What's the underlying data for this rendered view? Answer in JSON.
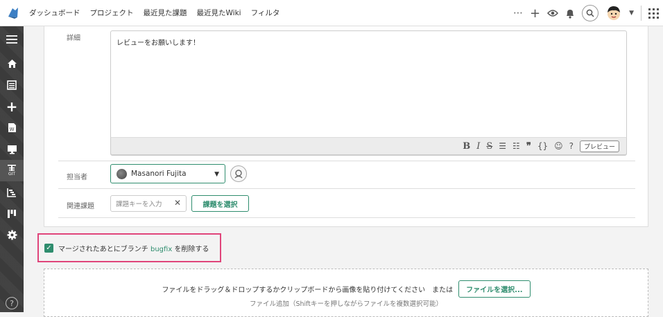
{
  "topbar": {
    "nav": [
      "ダッシュボード",
      "プロジェクト",
      "最近見た課題",
      "最近見たWiki",
      "フィルタ"
    ],
    "icons": [
      "more-icon",
      "plus-icon",
      "eye-icon",
      "bell-icon",
      "search-icon",
      "user-avatar-icon",
      "apps-grid-icon"
    ]
  },
  "sidebar": {
    "items": [
      "menu-icon",
      "home-icon",
      "issues-icon",
      "add-icon",
      "wiki-icon",
      "files-icon",
      "git-icon",
      "gantt-icon",
      "board-icon",
      "settings-icon"
    ],
    "git_label": "GIT",
    "help": "?"
  },
  "form": {
    "description_label": "詳細",
    "description_value": "レビューをお願いします！",
    "assignee_label": "担当者",
    "assignee_value": "Masanori Fujita",
    "related_label": "関連課題",
    "related_placeholder": "課題キーを入力",
    "related_select": "課題を選択",
    "preview": "プレビュー"
  },
  "delete_branch": {
    "before": "マージされたあとにブランチ",
    "branch": "bugfix",
    "after": "を削除する",
    "checked": true
  },
  "dropzone": {
    "text": "ファイルをドラッグ＆ドロップするかクリップボードから画像を貼り付けてください　または",
    "button": "ファイルを選択...",
    "sub": "ファイル追加（Shiftキーを押しながらファイルを複数選択可能）"
  },
  "colors": {
    "accent": "#2f8d6e",
    "highlight": "#e0447a"
  }
}
